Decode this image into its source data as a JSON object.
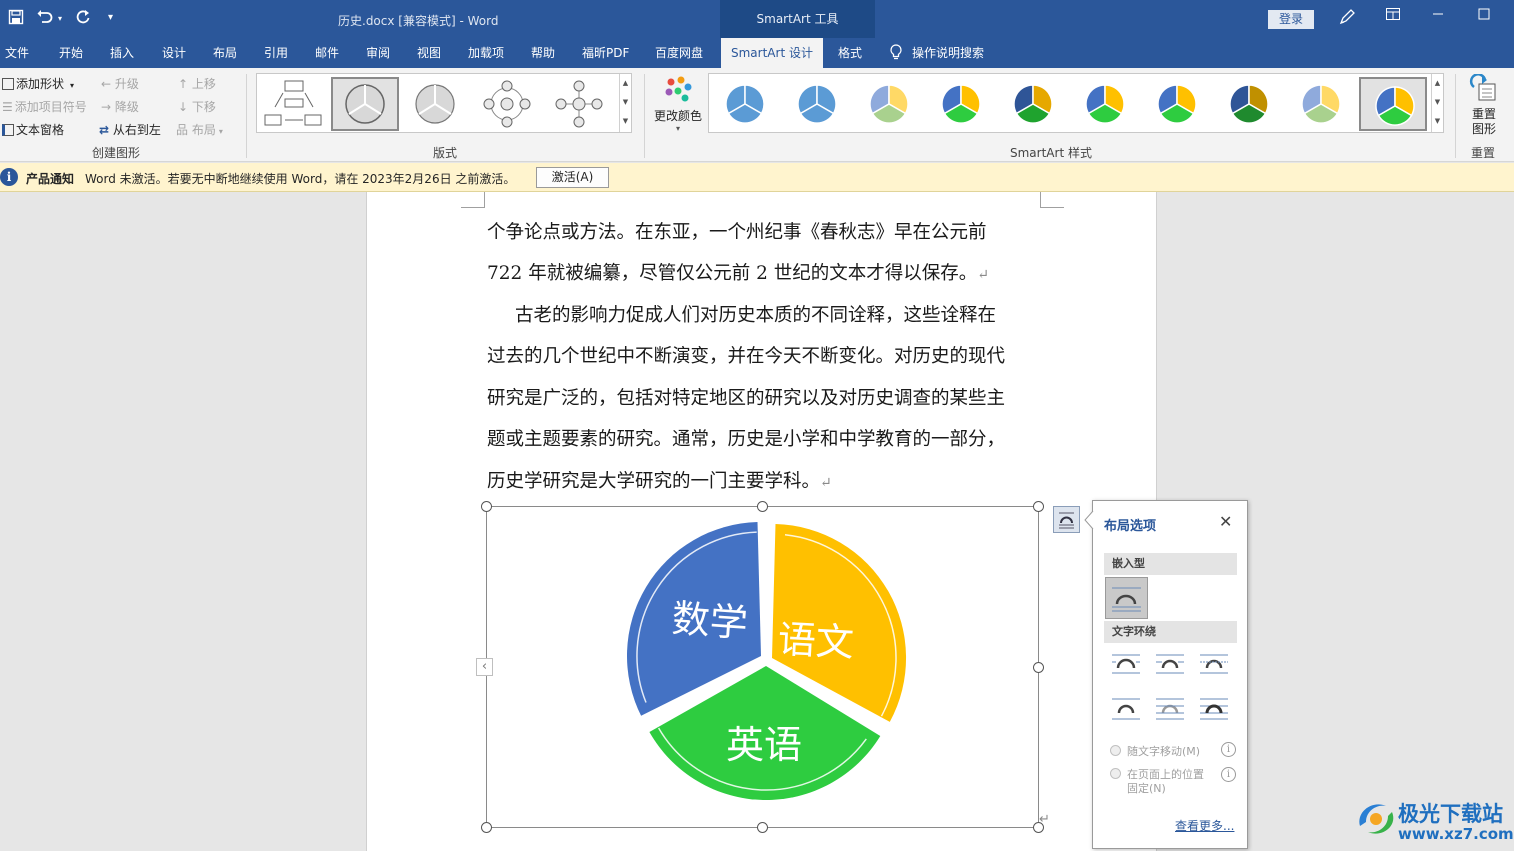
{
  "titlebar": {
    "doc_title": "历史.docx [兼容模式] - Word",
    "context_tab_header": "SmartArt 工具",
    "login": "登录"
  },
  "menu": {
    "tabs": [
      "文件",
      "开始",
      "插入",
      "设计",
      "布局",
      "引用",
      "邮件",
      "审阅",
      "视图",
      "加载项",
      "帮助",
      "福昕PDF",
      "百度网盘",
      "SmartArt 设计",
      "格式"
    ],
    "active_tab": "SmartArt 设计",
    "tell_me": "操作说明搜索"
  },
  "ribbon": {
    "create": {
      "add_shape": "添加形状",
      "add_bullet": "添加项目符号",
      "text_pane": "文本窗格",
      "promote": "升级",
      "demote": "降级",
      "right_to_left": "从右到左",
      "move_up": "上移",
      "move_down": "下移",
      "layout": "布局",
      "group_label": "创建图形"
    },
    "layouts": {
      "group_label": "版式"
    },
    "change_colors": "更改颜色",
    "styles": {
      "group_label": "SmartArt 样式"
    },
    "reset": {
      "button": "重置图形",
      "group_label": "重置"
    }
  },
  "notification": {
    "title": "产品通知",
    "text": "Word 未激活。若要无中断地继续使用 Word，请在 2023年2月26日 之前激活。",
    "button": "激活(A)"
  },
  "document": {
    "lines": [
      "个争论点或方法。在东亚，一个州纪事《春秋志》早在公元前",
      "722 年就被编纂，尽管仅公元前 2 世纪的文本才得以保存。",
      "古老的影响力促成人们对历史本质的不同诠释，这些诠释在",
      "过去的几个世纪中不断演变，并在今天不断变化。对历史的现代",
      "研究是广泛的，包括对特定地区的研究以及对历史调查的某些主",
      "题或主题要素的研究。通常，历史是小学和中学教育的一部分，",
      "历史学研究是大学研究的一门主要学科。"
    ]
  },
  "smartart": {
    "segments": [
      "数学",
      "语文",
      "英语"
    ],
    "colors": {
      "math": "#4472c4",
      "chinese": "#ffc000",
      "english": "#2ecc40"
    }
  },
  "layout_panel": {
    "title": "布局选项",
    "inline_section": "嵌入型",
    "wrap_section": "文字环绕",
    "move_with_text": "随文字移动(M)",
    "fix_position_line1": "在页面上的位置",
    "fix_position_line2": "固定(N)",
    "see_more": "查看更多..."
  },
  "watermark": {
    "name": "极光下载站",
    "url": "www.xz7.com"
  }
}
